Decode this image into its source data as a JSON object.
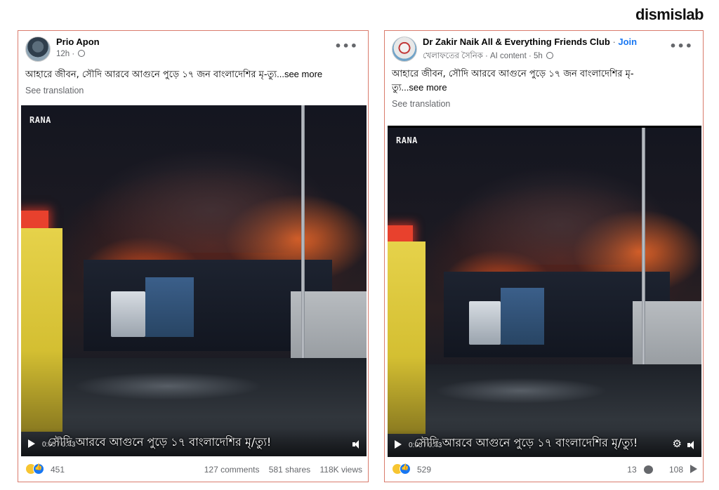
{
  "brand": "dismislab",
  "posts": [
    {
      "author": "Prio Apon",
      "time": "12h",
      "caption": "আহারে জীবন, সৌদি আরবে আগুনে পুড়ে ১৭ জন বাংলাদেশির মৃ-ত্যু",
      "see_more": "...see more",
      "see_translation": "See translation",
      "watermark": "RANA",
      "video_time": "0:00 / 0:43",
      "subtitle": "সৌদি আরবে আগুনে পুড়ে ১৭ বাংলাদেশির মৃ/ত্যু!",
      "reaction_count": "451",
      "comments": "127 comments",
      "shares": "581 shares",
      "views": "118K views"
    },
    {
      "author": "Dr Zakir Naik All & Everything Friends Club",
      "join": "Join",
      "subgroup": "খেলাফতের সৈনিক",
      "ai_label": "AI content",
      "time": "5h",
      "caption_line1": "আহারে জীবন, সৌদি আরবে আগুনে পুড়ে ১৭ জন বাংলাদেশির মৃ-",
      "caption_line2": "ত্যু",
      "see_more": "...see more",
      "see_translation": "See translation",
      "watermark": "RANA",
      "video_time": "0:00 / 0:43",
      "subtitle": "সৌদি আরবে আগুনে পুড়ে ১৭ বাংলাদেশির মৃ/ত্যু!",
      "reaction_count": "529",
      "comments": "13",
      "shares": "108"
    }
  ]
}
